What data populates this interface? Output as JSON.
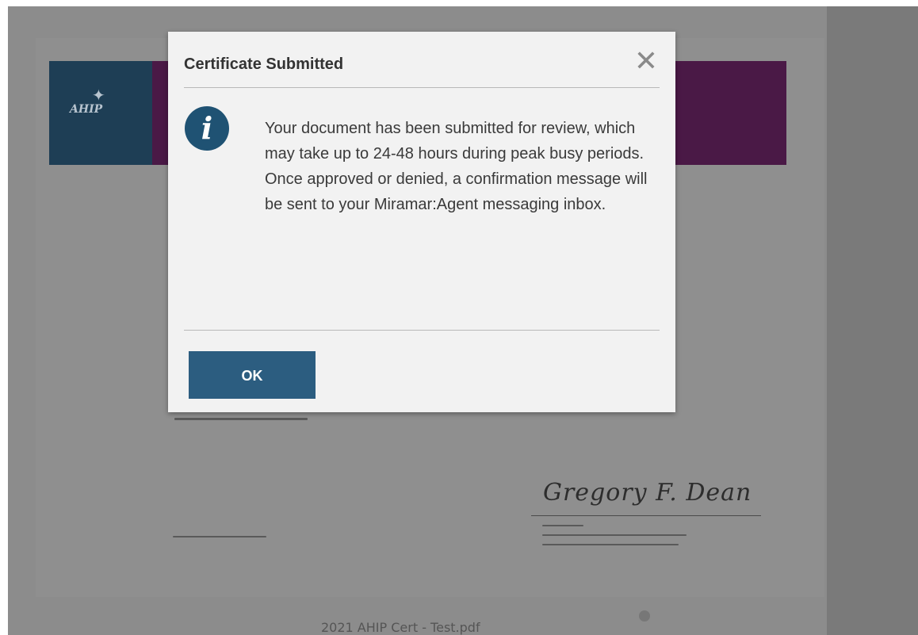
{
  "dialog": {
    "title": "Certificate Submitted",
    "close_glyph": "✕",
    "icon_glyph": "i",
    "message": "Your document has been submitted for review, which may take up to 24-48 hours during peak busy periods. Once approved or denied, a confirmation message will be sent to your Miramar:Agent messaging inbox.",
    "ok_label": "OK"
  },
  "background": {
    "logo_text": "AHIP",
    "signature_text": "Gregory F. Dean",
    "file_name": "2021 AHIP Cert - Test.pdf"
  },
  "colors": {
    "dialog_bg": "#f2f2f2",
    "icon_bg": "#1f5273",
    "ok_bg": "#2c5d80",
    "banner_blue": "#1e3e55",
    "banner_purple": "#4a1946"
  },
  "icons": {
    "close": "close-icon",
    "info": "info-icon",
    "gear": "gear-icon"
  }
}
